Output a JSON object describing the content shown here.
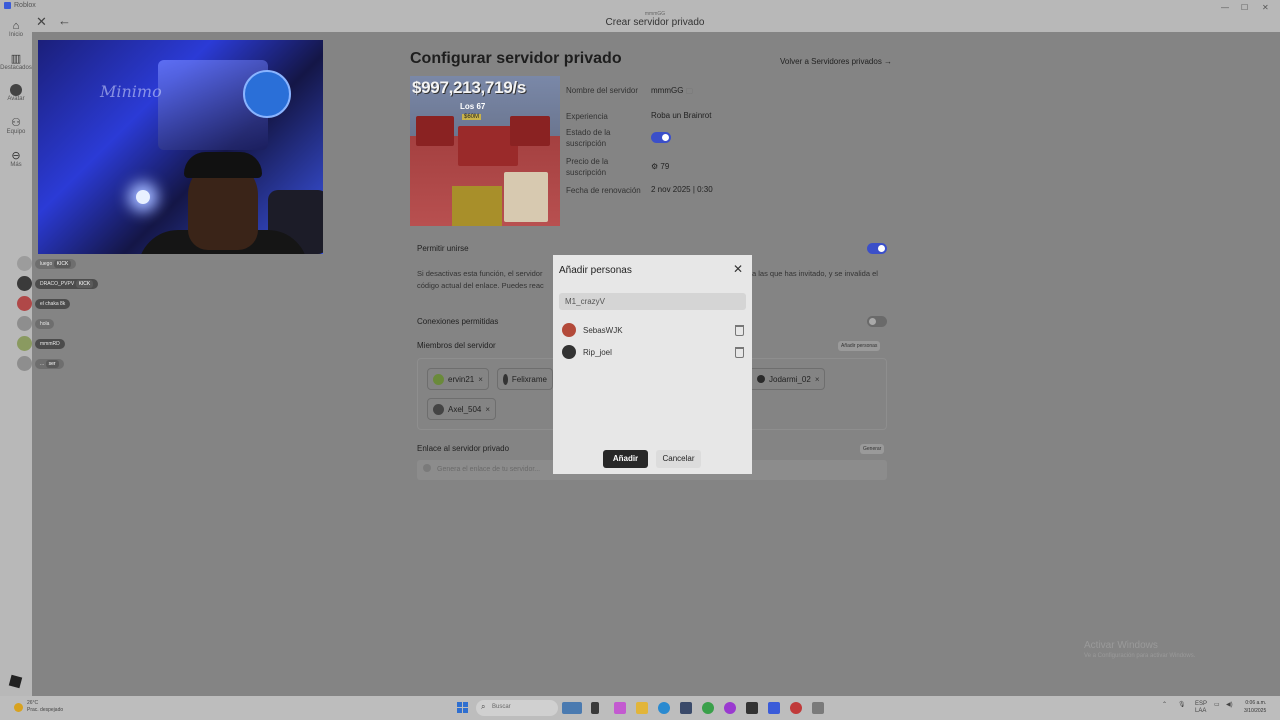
{
  "window": {
    "app_name": "Roblox",
    "header_small": "mmmGG",
    "header_title": "Crear servidor privado",
    "minimize": "—",
    "maximize": "☐",
    "close": "✕"
  },
  "sidebar": {
    "items": [
      {
        "label": "Inicio",
        "icon": "home-icon"
      },
      {
        "label": "Destacados",
        "icon": "chart-icon"
      },
      {
        "label": "Avatar",
        "icon": "avatar-icon"
      },
      {
        "label": "Equipo",
        "icon": "group-icon"
      },
      {
        "label": "Más",
        "icon": "more-icon"
      }
    ]
  },
  "overlay": {
    "webcam_text": "Minimo",
    "chat": [
      {
        "user": "luego",
        "badge": "KICK"
      },
      {
        "user": "DRACO_PVPV",
        "badge": "KICK"
      },
      {
        "user": "el chaka 8k",
        "badge": ""
      },
      {
        "user": "hola",
        "badge": ""
      },
      {
        "user": "mmmRD",
        "badge": ""
      },
      {
        "user": "...",
        "badge": "ser"
      }
    ]
  },
  "page": {
    "title": "Configurar servidor privado",
    "back_link": "Volver a Servidores privados →"
  },
  "thumbnail": {
    "money": "$997,213,719/s",
    "label": "Los 67",
    "sublabel": "$60M"
  },
  "info": {
    "server_name_label": "Nombre del servidor",
    "server_name_value": "mmmGG",
    "experience_label": "Experiencia",
    "experience_value": "Roba un Brainrot",
    "subscription_status_label": "Estado de la suscripción",
    "subscription_status_on": true,
    "subscription_price_label": "Precio de la suscripción",
    "subscription_price_value": "79",
    "renewal_label": "Fecha de renovación",
    "renewal_value": "2 nov 2025 | 0:30"
  },
  "sections": {
    "allow_join_label": "Permitir unirse",
    "allow_join_on": true,
    "allow_join_desc_left": "Si desactivas esta función, el servidor",
    "allow_join_desc_right": "a las que has invitado, y se invalida el",
    "allow_join_desc_line2": "código actual del enlace. Puedes reac",
    "connections_label": "Conexiones permitidas",
    "connections_on": false,
    "members_label": "Miembros del servidor",
    "members_add_button": "Añadir personas",
    "members": [
      "ervin21",
      "Felixrame",
      "Jodarmi_02",
      "Axel_504"
    ],
    "link_label": "Enlace al servidor privado",
    "link_generate_button": "Generar",
    "link_placeholder": "Genera el enlace de tu servidor..."
  },
  "modal": {
    "title": "Añadir personas",
    "input_value": "M1_crazyV",
    "results": [
      {
        "name": "SebasWJK",
        "color": "#b34a3a"
      },
      {
        "name": "Rip_joel",
        "color": "#333333"
      }
    ],
    "add_button": "Añadir",
    "cancel_button": "Cancelar"
  },
  "watermark": {
    "title": "Activar Windows",
    "subtitle": "Ve a Configuración para activar Windows."
  },
  "taskbar": {
    "weather_temp": "26°C",
    "weather_desc": "Prac. despejado",
    "search_placeholder": "Buscar",
    "lang": "ESP",
    "lang2": "LAA",
    "time": "0:06 a.m.",
    "date": "3/10/2025"
  }
}
